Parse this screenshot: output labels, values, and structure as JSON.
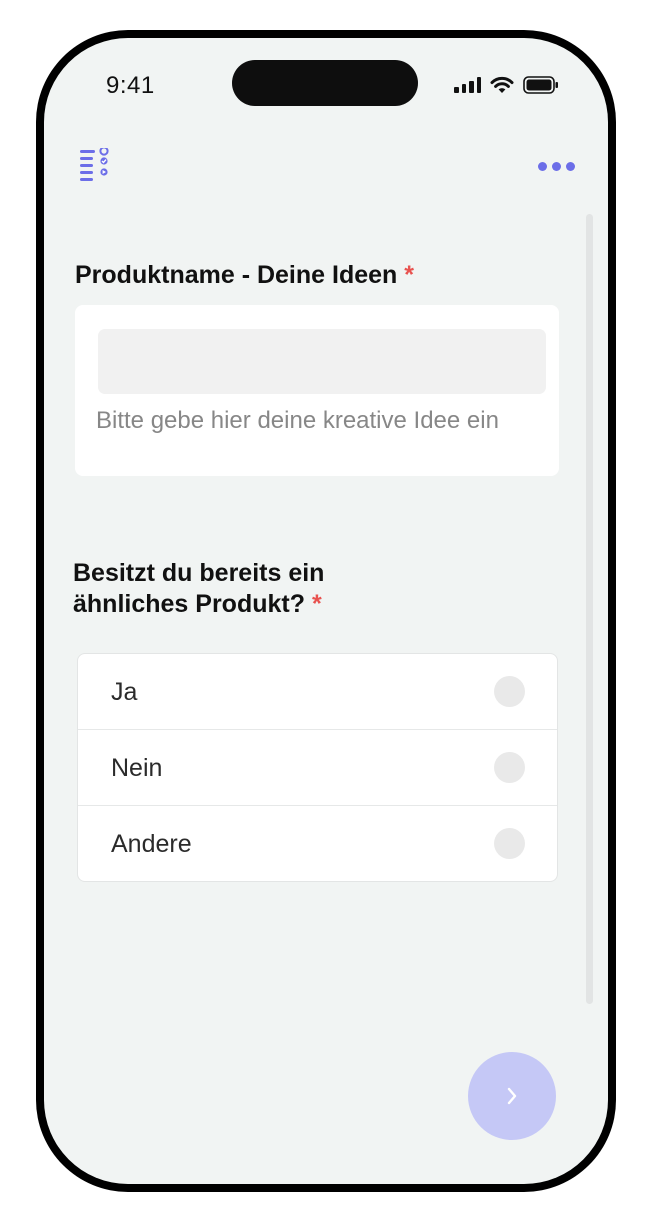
{
  "status_bar": {
    "time": "9:41"
  },
  "header": {
    "app_icon": "survey-list-icon",
    "menu_icon": "more-dots-icon"
  },
  "questions": [
    {
      "title": "Produktname - Deine Ideen",
      "required_mark": "*",
      "input_value": "",
      "hint": "Bitte gebe hier deine kreative Idee ein"
    },
    {
      "title_line1": "Besitzt du bereits ein",
      "title_line2": "ähnliches Produkt?",
      "required_mark": "*",
      "options": [
        {
          "label": "Ja"
        },
        {
          "label": "Nein"
        },
        {
          "label": "Andere"
        }
      ]
    }
  ],
  "next_button": {
    "icon": "chevron-right-icon"
  },
  "colors": {
    "accent": "#6c6ee8",
    "required": "#e8524f",
    "next_button_bg": "#c5c8f6",
    "screen_bg": "#f1f4f3"
  }
}
